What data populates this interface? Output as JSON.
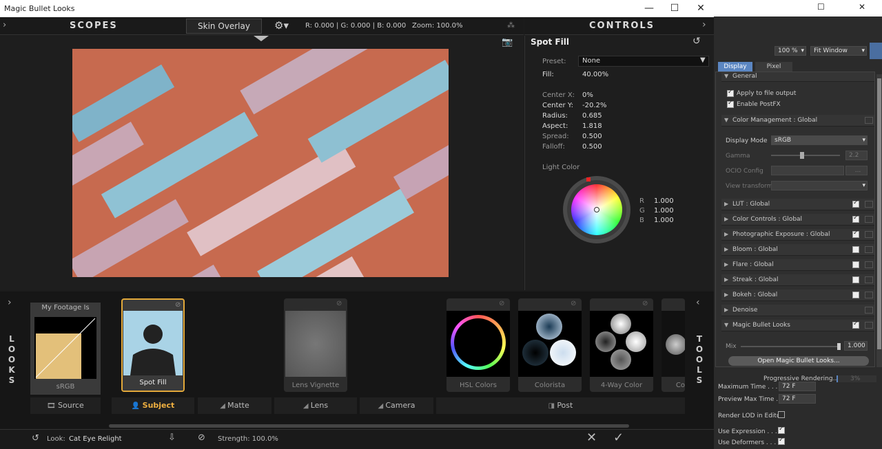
{
  "window": {
    "title": "Magic Bullet Looks",
    "minimize": "—",
    "maximize": "☐",
    "close": "✕"
  },
  "scopes_bar": {
    "title": "SCOPES",
    "skin_overlay": "Skin Overlay",
    "readout": "R: 0.000 | G: 0.000 | B: 0.000",
    "zoom": "Zoom: 100.0%"
  },
  "controls": {
    "title": "CONTROLS",
    "tool_name": "Spot Fill",
    "preset_label": "Preset:",
    "preset_value": "None",
    "fill_label": "Fill:",
    "fill_value": "40.00%",
    "center_x_label": "Center X:",
    "center_x_value": "0%",
    "center_y_label": "Center Y:",
    "center_y_value": "-20.2%",
    "radius_label": "Radius:",
    "radius_value": "0.685",
    "aspect_label": "Aspect:",
    "aspect_value": "1.818",
    "spread_label": "Spread:",
    "spread_value": "0.500",
    "falloff_label": "Falloff:",
    "falloff_value": "0.500",
    "light_color_label": "Light Color",
    "r_label": "R",
    "r_value": "1.000",
    "g_label": "G",
    "g_value": "1.000",
    "b_label": "B",
    "b_value": "1.000"
  },
  "looks_letters": [
    "L",
    "O",
    "O",
    "K",
    "S"
  ],
  "tools_letters": [
    "T",
    "O",
    "O",
    "L",
    "S"
  ],
  "cards": {
    "footage_title": "My Footage Is",
    "footage_name": "sRGB",
    "spot_fill": "Spot Fill",
    "lens_vignette": "Lens Vignette",
    "hsl_colors": "HSL Colors",
    "colorista": "Colorista",
    "four_way": "4-Way Color",
    "partial": "Co"
  },
  "stages": {
    "source": "Source",
    "subject": "Subject",
    "matte": "Matte",
    "lens": "Lens",
    "camera": "Camera",
    "post": "Post"
  },
  "status": {
    "look_label": "Look:",
    "look_value": "Cat Eye Relight",
    "strength": "Strength: 100.0%"
  },
  "right_panel": {
    "zoom_value": "100 %",
    "fit_window": "Fit Window",
    "tab_display": "Display",
    "tab_pixel": "Pixel",
    "general": "General",
    "apply_output": "Apply to file output",
    "enable_postfx": "Enable PostFX",
    "color_mgmt": "Color Management : Global",
    "display_mode_label": "Display Mode",
    "display_mode_value": "sRGB",
    "gamma_label": "Gamma",
    "gamma_value": "2.2",
    "ocio_label": "OCIO Config",
    "ocio_btn": "...",
    "view_transform_label": "View transform",
    "lut": "LUT : Global",
    "color_controls": "Color Controls : Global",
    "photo_exposure": "Photographic Exposure : Global",
    "bloom": "Bloom : Global",
    "flare": "Flare : Global",
    "streak": "Streak : Global",
    "bokeh": "Bokeh : Global",
    "denoise": "Denoise",
    "mbl": "Magic Bullet Looks",
    "mix_label": "Mix",
    "mix_value": "1.000",
    "open_mbl": "Open Magic Bullet Looks...",
    "progressive": "Progressive Rendering...",
    "progressive_pct": "3%",
    "max_time_label": "Maximum Time . . .",
    "max_time_value": "72 F",
    "preview_max_label": "Preview Max Time .",
    "preview_max_value": "72 F",
    "render_lod": "Render LOD in Editor",
    "use_expression": "Use Expression . . . .",
    "use_deformers": "Use Deformers . . . ."
  }
}
